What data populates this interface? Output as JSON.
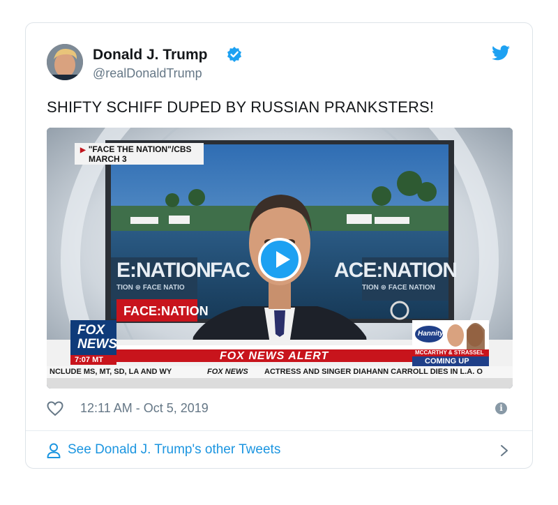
{
  "tweet": {
    "author_name": "Donald J. Trump",
    "handle": "@realDonaldTrump",
    "verified": true,
    "text": "SHIFTY SCHIFF DUPED BY RUSSIAN PRANKSTERS!",
    "timestamp": "12:11 AM - Oct 5, 2019",
    "footer_link": "See Donald J. Trump's other Tweets",
    "brand_color": "#1da1f2"
  },
  "video": {
    "source_label_line1": "\"FACE THE NATION\"/CBS",
    "source_label_line2": "MARCH 3",
    "backdrop_left": "E:NATION",
    "backdrop_left_sub": "TION ⊛ FACE NATIO",
    "backdrop_mid": "FAC",
    "backdrop_right": "ACE:NATION",
    "backdrop_right_sub": "TION ⊛ FACE NATION",
    "show_logo": "FACE:NATION",
    "network_logo_line1": "FOX",
    "network_logo_line2": "NEWS",
    "clock": "7:07 MT",
    "alert_banner": "FOX NEWS ALERT",
    "promo_show": "Hannity",
    "promo_guests": "MCCARTHY & STRASSEL",
    "promo_status": "COMING UP",
    "ticker_left": "NCLUDE MS, MT, SD, LA AND WY",
    "ticker_brand": "FOX NEWS",
    "ticker_right": "ACTRESS AND SINGER DIAHANN CARROLL DIES IN L.A. O"
  }
}
